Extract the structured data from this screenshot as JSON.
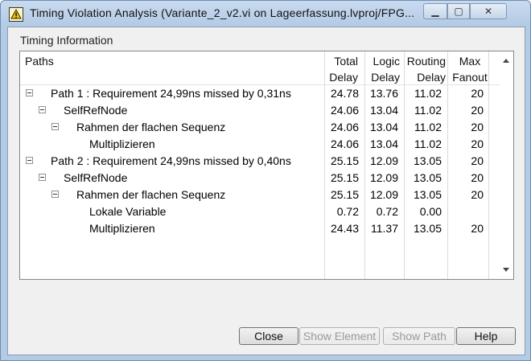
{
  "window": {
    "title": "Timing Violation Analysis (Variante_2_v2.vi on Lageerfassung.lvproj/FPG...",
    "icons": {
      "app": "labview-icon",
      "min": "minimize-icon",
      "max": "maximize-icon",
      "close": "close-icon"
    }
  },
  "group": {
    "label": "Timing Information"
  },
  "columns": {
    "paths": "Paths",
    "total": [
      "Total",
      "Delay"
    ],
    "logic": [
      "Logic",
      "Delay"
    ],
    "routing": [
      "Routing",
      "Delay"
    ],
    "fanout": [
      "Max",
      "Fanout"
    ]
  },
  "rows": [
    {
      "label": "Path 1 : Requirement 24,99ns missed by 0,31ns",
      "total": "24.78",
      "logic": "13.76",
      "routing": "11.02",
      "fanout": "20"
    },
    {
      "label": "SelfRefNode",
      "total": "24.06",
      "logic": "13.04",
      "routing": "11.02",
      "fanout": "20"
    },
    {
      "label": "Rahmen der flachen Sequenz",
      "total": "24.06",
      "logic": "13.04",
      "routing": "11.02",
      "fanout": "20"
    },
    {
      "label": "Multiplizieren",
      "total": "24.06",
      "logic": "13.04",
      "routing": "11.02",
      "fanout": "20"
    },
    {
      "label": "Path 2 : Requirement 24,99ns missed by 0,40ns",
      "total": "25.15",
      "logic": "12.09",
      "routing": "13.05",
      "fanout": "20"
    },
    {
      "label": "SelfRefNode",
      "total": "25.15",
      "logic": "12.09",
      "routing": "13.05",
      "fanout": "20"
    },
    {
      "label": "Rahmen der flachen Sequenz",
      "total": "25.15",
      "logic": "12.09",
      "routing": "13.05",
      "fanout": "20"
    },
    {
      "label": "Lokale Variable",
      "total": "0.72",
      "logic": "0.72",
      "routing": "0.00",
      "fanout": ""
    },
    {
      "label": "Multiplizieren",
      "total": "24.43",
      "logic": "11.37",
      "routing": "13.05",
      "fanout": "20"
    }
  ],
  "buttons": {
    "close": "Close",
    "show_element": "Show Element",
    "show_path": "Show Path",
    "help": "Help"
  }
}
